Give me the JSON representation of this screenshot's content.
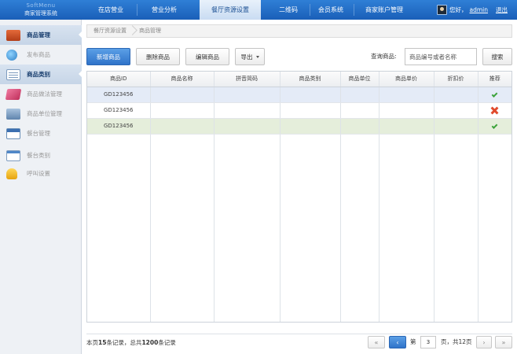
{
  "app": {
    "logo_line1": "SoftMenu",
    "logo_line2": "商家管理系统"
  },
  "nav": {
    "items": [
      {
        "label": "在店营业"
      },
      {
        "label": "营业分析"
      },
      {
        "label": "餐厅资源设置",
        "active": true
      },
      {
        "label": "二维码"
      },
      {
        "label": "会员系统"
      },
      {
        "label": "商家账户管理"
      }
    ]
  },
  "user": {
    "greeting": "您好，",
    "name": "admin",
    "logout": "退出"
  },
  "sidebar": {
    "items": [
      {
        "label": "商品管理",
        "icon": "book-icon",
        "active": true
      },
      {
        "label": "发布商品",
        "icon": "globe-icon"
      },
      {
        "label": "商品类别",
        "icon": "sheet-icon",
        "active": true
      },
      {
        "label": "商品做法管理",
        "icon": "recipe-icon"
      },
      {
        "label": "商品单位管理",
        "icon": "box-icon"
      },
      {
        "label": "餐台管理",
        "icon": "calendar-icon"
      },
      {
        "label": "餐台类别",
        "icon": "window-icon"
      },
      {
        "label": "呼叫设置",
        "icon": "bell-icon"
      }
    ]
  },
  "breadcrumb": {
    "items": [
      "餐厅资源设置",
      "商品管理"
    ]
  },
  "toolbar": {
    "add_label": "新增商品",
    "delete_label": "删除商品",
    "edit_label": "编辑商品",
    "export_label": "导出"
  },
  "search": {
    "label": "查询商品:",
    "placeholder": "商品编号或者名称",
    "button_label": "搜索"
  },
  "table": {
    "columns": [
      "商品ID",
      "商品名称",
      "拼音简码",
      "商品类别",
      "商品单位",
      "商品单价",
      "折扣价",
      "推荐"
    ],
    "rows": [
      {
        "id": "GD123456",
        "recommended": true
      },
      {
        "id": "GD123456",
        "recommended": false
      },
      {
        "id": "GD123456",
        "recommended": true
      }
    ]
  },
  "footer": {
    "summary_prefix": "本页",
    "page_count": "15",
    "summary_middle": "条记录，总共",
    "total_count": "1200",
    "summary_suffix": "条记录",
    "page_prefix": "第",
    "current_page": "3",
    "page_suffix": "页，共12页"
  },
  "colors": {
    "header_blue": "#1a5fb8",
    "primary_button": "#2f73c9",
    "row_selected": "#e4ebf7",
    "row_highlight": "#e5eedb",
    "check_green": "#3da33b",
    "cross_red": "#e04a2c"
  }
}
